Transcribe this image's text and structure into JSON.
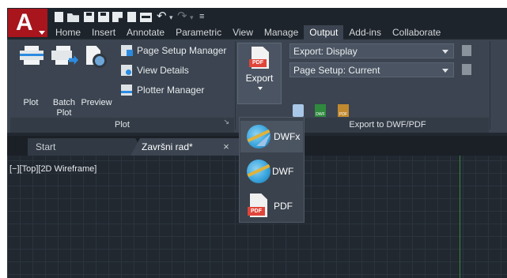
{
  "app": {
    "logo_letter": "A"
  },
  "ribbon_tabs": [
    "Home",
    "Insert",
    "Annotate",
    "Parametric",
    "View",
    "Manage",
    "Output",
    "Add-ins",
    "Collaborate"
  ],
  "active_tab": "Output",
  "plot_panel": {
    "plot_label": "Plot",
    "batch_plot_label": "Batch\nPlot",
    "preview_label": "Preview",
    "page_setup_manager": "Page Setup Manager",
    "view_details": "View Details",
    "plotter_manager": "Plotter Manager",
    "title": "Plot"
  },
  "export_button": {
    "label": "Export",
    "icon_text": "PDF"
  },
  "dwf_panel": {
    "export_combo": "Export: Display",
    "page_setup_combo": "Page Setup: Current",
    "title": "Export to DWF/PDF",
    "mini_tag_dwf": "DWF",
    "mini_tag_pdf": "PDF"
  },
  "file_tabs": {
    "start": "Start",
    "document": "Završni rad*",
    "close_glyph": "×"
  },
  "viewport": {
    "label": "[−][Top][2D Wireframe]"
  },
  "export_menu": {
    "items": [
      {
        "label": "DWFx"
      },
      {
        "label": "DWF"
      },
      {
        "label": "PDF",
        "icon_text": "PDF"
      }
    ]
  },
  "colors": {
    "app_red": "#a8151d",
    "ribbon_bg": "#3b4450",
    "canvas_bg": "#212830",
    "accent_blue": "#2b8be0",
    "pdf_red": "#e0453a",
    "axis_green": "#3a8a3a"
  }
}
